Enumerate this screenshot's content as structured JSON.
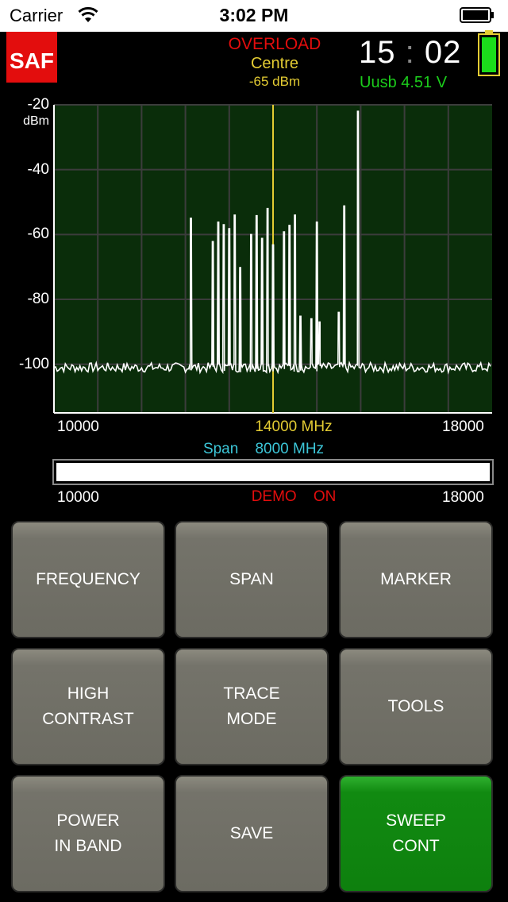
{
  "statusbar": {
    "carrier": "Carrier",
    "time": "3:02 PM"
  },
  "logo": {
    "text": "SAF",
    "color": "#e30d0d"
  },
  "header": {
    "overload": "OVERLOAD",
    "centre_label": "Centre",
    "centre_level": "-65 dBm",
    "clock_hours": "15",
    "clock_sep": ":",
    "clock_minutes": "02",
    "usb_voltage": "Uusb 4.51 V"
  },
  "chart_data": {
    "type": "line",
    "title": "",
    "xlabel": "",
    "ylabel": "dBm",
    "xlim": [
      10000,
      18000
    ],
    "ylim": [
      -115,
      -20
    ],
    "yticks": [
      "-20",
      "-40",
      "-60",
      "-80",
      "-100"
    ],
    "ytick_values": [
      -20,
      -40,
      -60,
      -80,
      -100
    ],
    "grid": true,
    "marker_x": 14000,
    "marker_color": "#e4cc33",
    "trace_color": "#ffffff",
    "plot_bg": "#0a2d0a",
    "grid_color": "#3c3c3c",
    "peaks": [
      {
        "x": 12500,
        "y": -55
      },
      {
        "x": 12900,
        "y": -62
      },
      {
        "x": 13000,
        "y": -56
      },
      {
        "x": 13100,
        "y": -57
      },
      {
        "x": 13200,
        "y": -58
      },
      {
        "x": 13300,
        "y": -54
      },
      {
        "x": 13400,
        "y": -70
      },
      {
        "x": 13600,
        "y": -60
      },
      {
        "x": 13700,
        "y": -54
      },
      {
        "x": 13800,
        "y": -61
      },
      {
        "x": 13900,
        "y": -52
      },
      {
        "x": 14000,
        "y": -63
      },
      {
        "x": 14200,
        "y": -59
      },
      {
        "x": 14300,
        "y": -57
      },
      {
        "x": 14400,
        "y": -54
      },
      {
        "x": 14500,
        "y": -85
      },
      {
        "x": 14700,
        "y": -86
      },
      {
        "x": 14800,
        "y": -56
      },
      {
        "x": 14850,
        "y": -87
      },
      {
        "x": 15200,
        "y": -84
      },
      {
        "x": 15300,
        "y": -51
      },
      {
        "x": 15550,
        "y": -22
      }
    ]
  },
  "freq": {
    "start": "10000",
    "stop": "18000",
    "centre": "14000",
    "centre_unit": "MHz",
    "span_label": "Span",
    "span_value": "8000",
    "span_unit": "MHz",
    "range_start": "10000",
    "range_stop": "18000",
    "demo_label": "DEMO",
    "demo_state": "ON"
  },
  "buttons": [
    {
      "line1": "FREQUENCY",
      "line2": ""
    },
    {
      "line1": "SPAN",
      "line2": ""
    },
    {
      "line1": "MARKER",
      "line2": ""
    },
    {
      "line1": "HIGH",
      "line2": "CONTRAST"
    },
    {
      "line1": "TRACE",
      "line2": "MODE"
    },
    {
      "line1": "TOOLS",
      "line2": ""
    },
    {
      "line1": "POWER",
      "line2": "IN BAND"
    },
    {
      "line1": "SAVE",
      "line2": ""
    },
    {
      "line1": "SWEEP",
      "line2": "CONT"
    }
  ]
}
